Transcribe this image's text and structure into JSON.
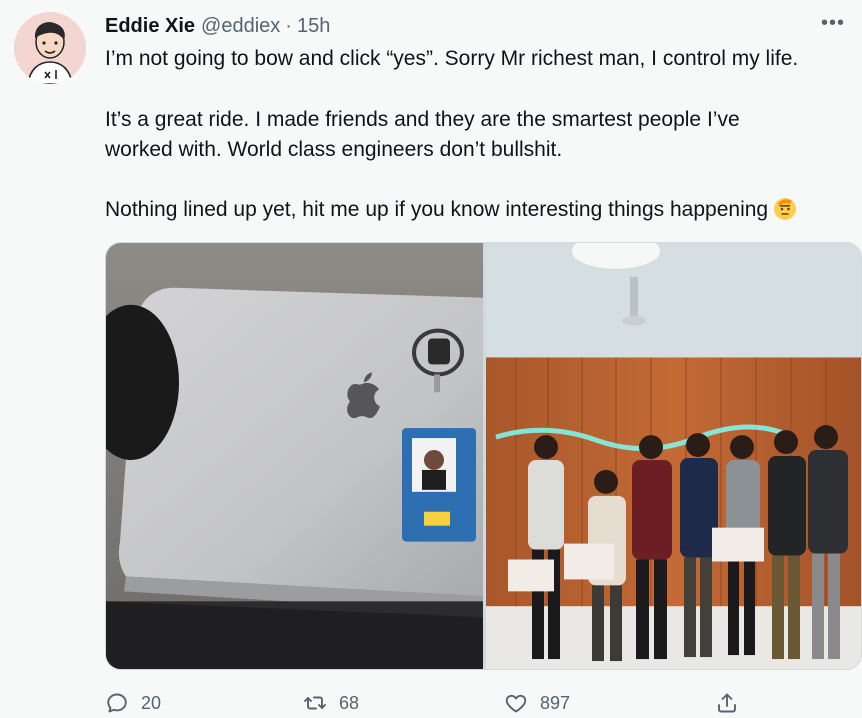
{
  "tweet": {
    "author_name": "Eddie Xie",
    "author_handle": "@eddiex",
    "separator": "·",
    "timestamp": "15h",
    "paragraphs": [
      "I’m not going to bow and click “yes”. Sorry Mr richest man, I control my life.",
      "It’s a great ride. I made friends and they are the smartest people I’ve worked with. World class engineers don’t bullshit.",
      "Nothing lined up yet, hit me up if you know interesting things happening"
    ],
    "p2_line1": "It’s a great ride. I made friends and they are the smartest people I’ve",
    "p2_line2": "worked with. World class engineers don’t bullshit.",
    "emoji": "saluting-face-emoji",
    "more_icon": "more-horizontal-icon"
  },
  "actions": {
    "reply": {
      "icon": "reply-icon",
      "count": "20"
    },
    "retweet": {
      "icon": "retweet-icon",
      "count": "68"
    },
    "like": {
      "icon": "heart-icon",
      "count": "897"
    },
    "share": {
      "icon": "share-icon"
    }
  },
  "colors": {
    "background": "#f7f9f9",
    "text": "#0f1419",
    "secondary": "#536471",
    "border": "#cfd9de"
  }
}
